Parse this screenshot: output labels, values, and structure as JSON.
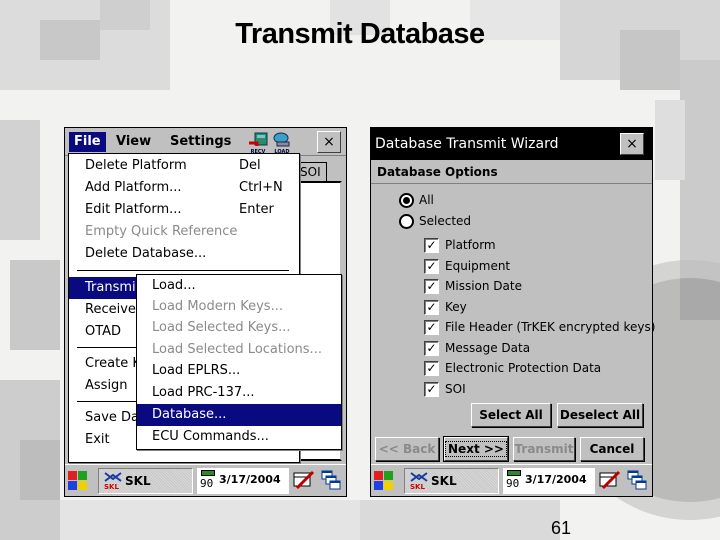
{
  "slide": {
    "title": "Transmit Database",
    "page_number": "61"
  },
  "left_screen": {
    "menubar": {
      "items": [
        "File",
        "View",
        "Settings"
      ],
      "active": "File",
      "toolbar_icons": [
        {
          "name": "recv-icon",
          "caption": "RECV"
        },
        {
          "name": "load-icon",
          "caption": "LOAD"
        }
      ],
      "close_label": "×"
    },
    "tab_label": "SOI",
    "file_menu": {
      "items": [
        {
          "label": "Delete Platform",
          "shortcut": "Del",
          "enabled": true
        },
        {
          "label": "Add Platform...",
          "shortcut": "Ctrl+N",
          "enabled": true
        },
        {
          "label": "Edit Platform...",
          "shortcut": "Enter",
          "enabled": true
        },
        {
          "label": "Empty Quick Reference",
          "shortcut": "",
          "enabled": false
        },
        {
          "label": "Delete Database...",
          "shortcut": "",
          "enabled": true
        },
        {
          "label": "Transmit",
          "shortcut": "",
          "enabled": true,
          "highlighted": true
        },
        {
          "label": "Receive",
          "shortcut": "",
          "enabled": true
        },
        {
          "label": "OTAD",
          "shortcut": "",
          "enabled": true
        },
        {
          "label": "Create K",
          "shortcut": "",
          "enabled": true
        },
        {
          "label": "Assign",
          "shortcut": "",
          "enabled": true
        },
        {
          "label": "Save Da",
          "shortcut": "",
          "enabled": true
        },
        {
          "label": "Exit",
          "shortcut": "",
          "enabled": true
        }
      ]
    },
    "transmit_submenu": {
      "items": [
        {
          "label": "Load...",
          "enabled": true
        },
        {
          "label": "Load Modern Keys...",
          "enabled": false
        },
        {
          "label": "Load Selected Keys...",
          "enabled": false
        },
        {
          "label": "Load Selected Locations...",
          "enabled": false
        },
        {
          "label": "Load EPLRS...",
          "enabled": true
        },
        {
          "label": "Load PRC-137...",
          "enabled": true
        },
        {
          "label": "Database...",
          "enabled": true,
          "highlighted": true
        },
        {
          "label": "ECU Commands...",
          "enabled": true
        }
      ]
    },
    "taskbar": {
      "app_label": "SKL",
      "app_icon_caption": "SKL",
      "battery_level": "90",
      "date": "3/17/2004"
    }
  },
  "right_screen": {
    "wizard": {
      "title": "Database Transmit Wizard",
      "close_label": "×",
      "section_title": "Database Options",
      "radios": [
        {
          "label": "All",
          "selected": true
        },
        {
          "label": "Selected",
          "selected": false
        }
      ],
      "checkboxes": [
        {
          "label": "Platform",
          "checked": true
        },
        {
          "label": "Equipment",
          "checked": true
        },
        {
          "label": "Mission Date",
          "checked": true
        },
        {
          "label": "Key",
          "checked": true
        },
        {
          "label": "File Header (TrKEK encrypted keys)",
          "checked": true
        },
        {
          "label": "Message Data",
          "checked": true
        },
        {
          "label": "Electronic Protection Data",
          "checked": true
        },
        {
          "label": "SOI",
          "checked": true
        }
      ],
      "select_all_label": "Select All",
      "deselect_all_label": "Deselect All",
      "nav_buttons": [
        {
          "label": "<< Back",
          "enabled": false
        },
        {
          "label": "Next >>",
          "enabled": true,
          "default": true
        },
        {
          "label": "Transmit",
          "enabled": false
        },
        {
          "label": "Cancel",
          "enabled": true
        }
      ]
    },
    "taskbar": {
      "app_label": "SKL",
      "app_icon_caption": "SKL",
      "battery_level": "90",
      "date": "3/17/2004"
    }
  },
  "colors": {
    "highlight": "#0a0a80",
    "window_face": "#c0c0c0",
    "disabled_text": "#8a8a8a"
  }
}
